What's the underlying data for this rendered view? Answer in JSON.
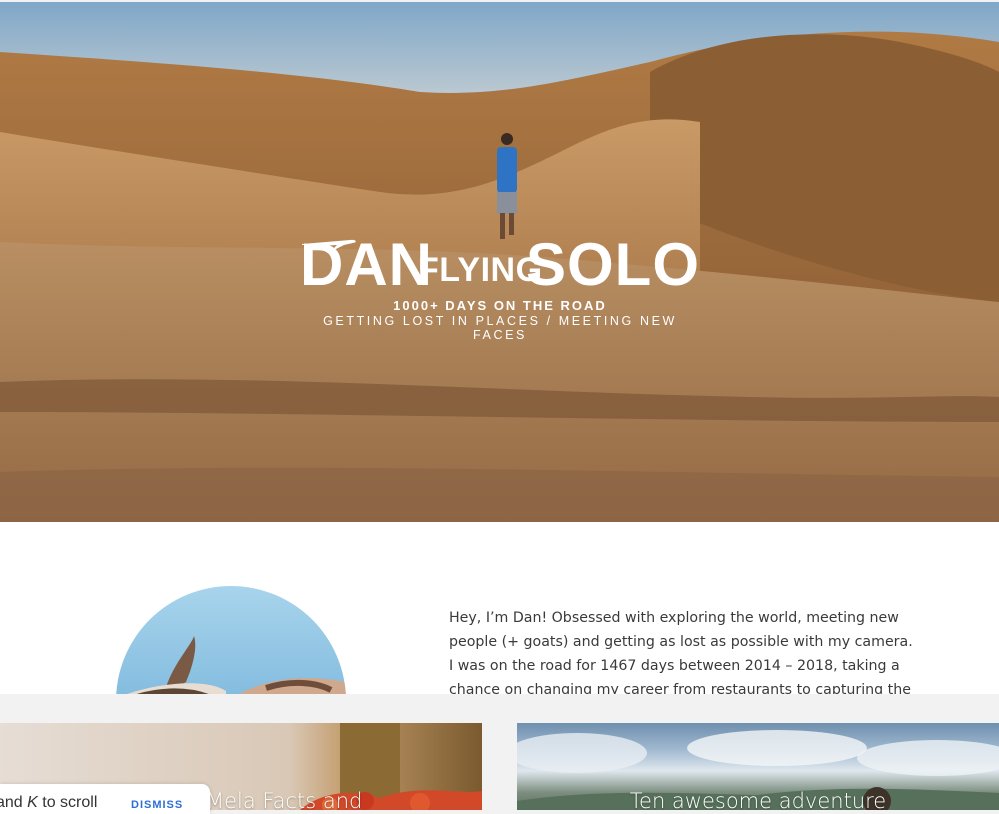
{
  "hero": {
    "logo": {
      "word_dan": "DAN",
      "word_flying": "FLYING",
      "word_solo": "SOLO",
      "days": "1000+ DAYS ON THE ROAD",
      "tagline": "GETTING LOST IN PLACES / MEETING NEW FACES"
    }
  },
  "about": {
    "text": "Hey, I’m Dan! Obsessed with exploring the world, meeting new people (+ goats) and getting as lost as possible with my camera. I was on the road for 1467 days between 2014 – 2018, taking a chance on changing my career from restaurants to capturing the world and somehow it all worked out."
  },
  "cards": [
    {
      "title": "Mela Facts and"
    },
    {
      "title": "Ten awesome adventure"
    }
  ],
  "toast": {
    "prefix": "and ",
    "key": "K",
    "suffix": " to scroll",
    "dismiss_label": "DISMISS"
  },
  "colors": {
    "link": "#2b6fd6",
    "body_text": "#3a3a3a"
  },
  "icons": {
    "plane": "plane-icon"
  }
}
